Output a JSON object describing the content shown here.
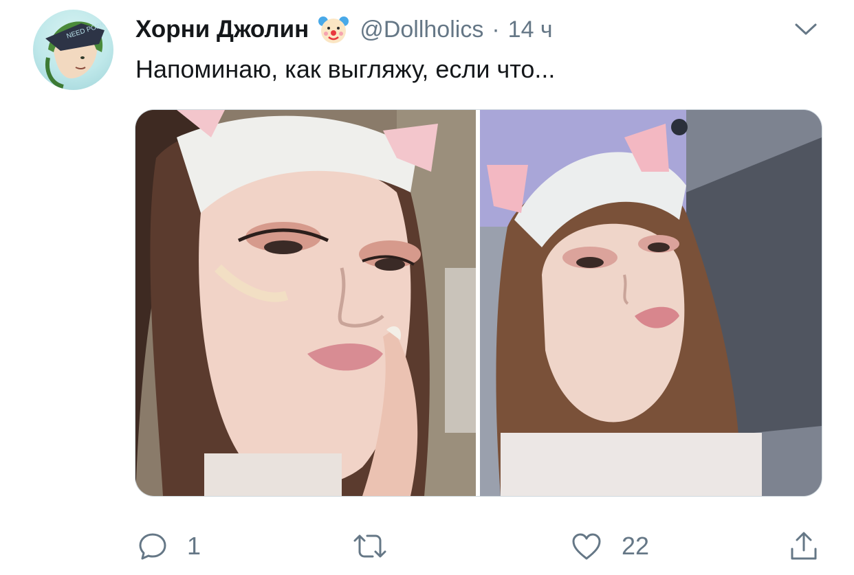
{
  "tweet": {
    "author_name": "Хорни Джолин",
    "author_emoji": "clown-face-icon",
    "handle": "@Dollholics",
    "separator": "·",
    "time": "14 ч",
    "text": "Напоминаю, как выгляжу, если что...",
    "avatar_text": "NEED PORN",
    "media": [
      {
        "kind": "photo",
        "subject": "selfie-left"
      },
      {
        "kind": "photo",
        "subject": "selfie-right"
      }
    ],
    "actions": {
      "reply_count": "1",
      "retweet_count": "",
      "like_count": "22"
    }
  },
  "colors": {
    "text": "#14171a",
    "muted": "#657786",
    "border": "#cfd9de",
    "background": "#ffffff"
  },
  "icons": [
    "chevron-down-icon",
    "reply-icon",
    "retweet-icon",
    "like-icon",
    "share-icon"
  ]
}
